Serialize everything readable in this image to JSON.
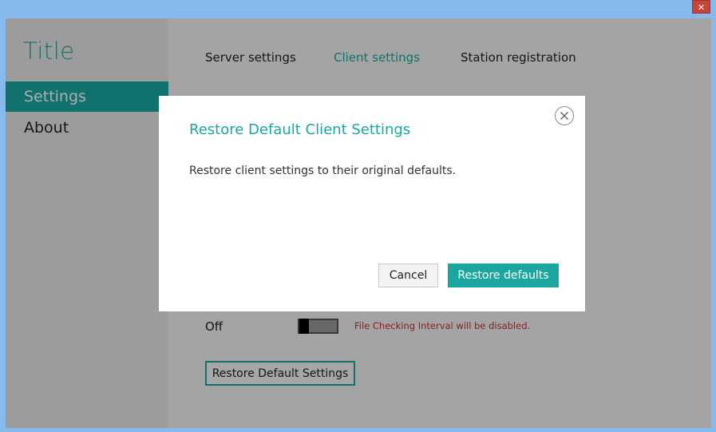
{
  "window": {
    "close_glyph": "✕",
    "close_color": "#c7443a"
  },
  "sidebar": {
    "title": "Title",
    "items": [
      {
        "label": "Settings",
        "active": true
      },
      {
        "label": "About",
        "active": false
      }
    ]
  },
  "tabs": [
    {
      "label": "Server settings",
      "active": false
    },
    {
      "label": "Client settings",
      "active": true
    },
    {
      "label": "Station registration",
      "active": false
    }
  ],
  "content": {
    "toggle_state_label": "Off",
    "toggle_on": false,
    "toggle_warning": "File Checking Interval will be disabled.",
    "restore_button_label": "Restore Default Settings"
  },
  "dialog": {
    "title": "Restore Default Client Settings",
    "body": "Restore client settings to their original defaults.",
    "cancel_label": "Cancel",
    "confirm_label": "Restore defaults",
    "close_icon": "close-circle-icon"
  },
  "colors": {
    "accent": "#1aa7a0",
    "warning": "#c0333a",
    "window_frame": "#86b9ec"
  }
}
